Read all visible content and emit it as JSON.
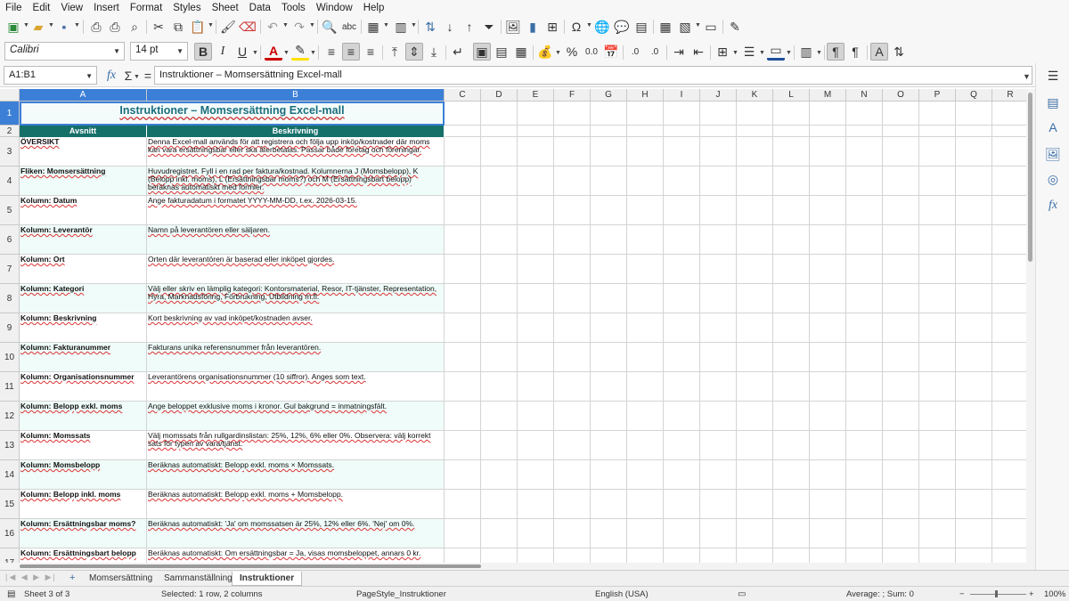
{
  "menu": [
    "File",
    "Edit",
    "View",
    "Insert",
    "Format",
    "Styles",
    "Sheet",
    "Data",
    "Tools",
    "Window",
    "Help"
  ],
  "toolbar": {
    "font_name": "Calibri",
    "font_size": "14 pt",
    "bold": "B",
    "italic": "I",
    "underline": "U",
    "percent": "%",
    "decimal": "0.0"
  },
  "formula_bar": {
    "name_box": "A1:B1",
    "formula": "Instruktioner – Momsersättning Excel-mall"
  },
  "columns": [
    "A",
    "B",
    "C",
    "D",
    "E",
    "F",
    "G",
    "H",
    "I",
    "J",
    "K",
    "L",
    "M",
    "N",
    "O",
    "P",
    "Q",
    "R"
  ],
  "row_numbers": [
    "1",
    "2",
    "3",
    "4",
    "5",
    "6",
    "7",
    "8",
    "9",
    "10",
    "11",
    "12",
    "13",
    "14",
    "15",
    "16",
    "17"
  ],
  "sheet": {
    "title": "Instruktioner – Momsersättning Excel-mall",
    "header_a": "Avsnitt",
    "header_b": "Beskrivning",
    "rows": [
      {
        "a": "ÖVERSIKT",
        "b": "Denna Excel-mall används för att registrera och följa upp inköp/kostnader där moms kan vara ersättningsbar eller ska återbetalas. Passar både företag och föreningar."
      },
      {
        "a": "Fliken: Momsersättning",
        "b": "Huvudregistret. Fyll i en rad per faktura/kostnad. Kolumnerna J (Momsbelopp), K (Belopp inkl. moms), L (Ersättningsbar moms?) och M (Ersättningsbart belopp) beräknas automatiskt med formler."
      },
      {
        "a": "Kolumn: Datum",
        "b": "Ange fakturadatum i formatet YYYY-MM-DD, t.ex. 2026-03-15."
      },
      {
        "a": "Kolumn: Leverantör",
        "b": "Namn på leverantören eller säljaren."
      },
      {
        "a": "Kolumn: Ort",
        "b": "Orten där leverantören är baserad eller inköpet gjordes."
      },
      {
        "a": "Kolumn: Kategori",
        "b": "Välj eller skriv en lämplig kategori: Kontorsmaterial, Resor, IT-tjänster, Representation, Hyra, Marknadsföring, Förbrukning, Utbildning m.fl."
      },
      {
        "a": "Kolumn: Beskrivning",
        "b": "Kort beskrivning av vad inköpet/kostnaden avser."
      },
      {
        "a": "Kolumn: Fakturanummer",
        "b": "Fakturans unika referensnummer från leverantören."
      },
      {
        "a": "Kolumn: Organisationsnummer",
        "b": "Leverantörens organisationsnummer (10 siffror). Anges som text."
      },
      {
        "a": "Kolumn: Belopp exkl. moms",
        "b": "Ange beloppet exklusive moms i kronor. Gul bakgrund = inmatningsfält."
      },
      {
        "a": "Kolumn: Momssats",
        "b": "Välj momssats från rullgardinslistan: 25%, 12%, 6% eller 0%. Observera: välj korrekt sats för typen av vara/tjänst."
      },
      {
        "a": "Kolumn: Momsbelopp",
        "b": "Beräknas automatiskt: Belopp exkl. moms × Momssats."
      },
      {
        "a": "Kolumn: Belopp inkl. moms",
        "b": "Beräknas automatiskt: Belopp exkl. moms + Momsbelopp."
      },
      {
        "a": "Kolumn: Ersättningsbar moms?",
        "b": "Beräknas automatiskt: 'Ja' om momssatsen är 25%, 12% eller 6%. 'Nej' om 0%."
      },
      {
        "a": "Kolumn: Ersättningsbart belopp",
        "b": "Beräknas automatiskt: Om ersättningsbar = Ja, visas momsbeloppet, annars 0 kr."
      }
    ]
  },
  "tabs": [
    "Momsersättning",
    "Sammanställning",
    "Instruktioner"
  ],
  "active_tab": "Instruktioner",
  "status": {
    "sheet": "Sheet 3 of 3",
    "selected": "Selected: 1 row, 2 columns",
    "page_style": "PageStyle_Instruktioner",
    "language": "English (USA)",
    "summary": "Average: ; Sum: 0",
    "zoom": "100%"
  },
  "colors": {
    "header_fill": "#16706a",
    "alt_row": "#effcf9",
    "title": "#1a6e7e",
    "selection": "#3c7fd6"
  }
}
